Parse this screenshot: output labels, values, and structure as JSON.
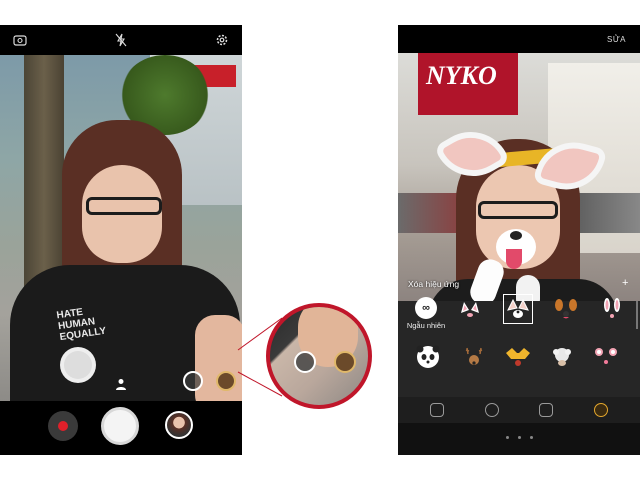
{
  "left_screen": {
    "shirt_text_line1": "HATE",
    "shirt_text_line2": "HUMAN",
    "shirt_text_line3": "EQUALLY",
    "icons": [
      "switch-camera-icon",
      "flash-off-icon",
      "settings-icon"
    ],
    "record_color": "#e0202a"
  },
  "right_screen": {
    "edit_label": "SỬA",
    "clear_effects_label": "Xóa hiệu ứng",
    "random_label": "Ngẫu nhiên",
    "random_icon_glyph": "∞",
    "sticker_row1": [
      "cat-ears",
      "fox-ears",
      "dog-ears",
      "bunny-ears"
    ],
    "sticker_row2": [
      "panda",
      "deer",
      "mask",
      "sheep",
      "mouse"
    ],
    "tabs": [
      "sticker-tab",
      "face-tab",
      "mask-tab",
      "animal-tab"
    ],
    "active_tab": "animal-tab",
    "accent_color": "#e3a72d"
  },
  "zoom": {
    "border_color": "#c0162a"
  }
}
